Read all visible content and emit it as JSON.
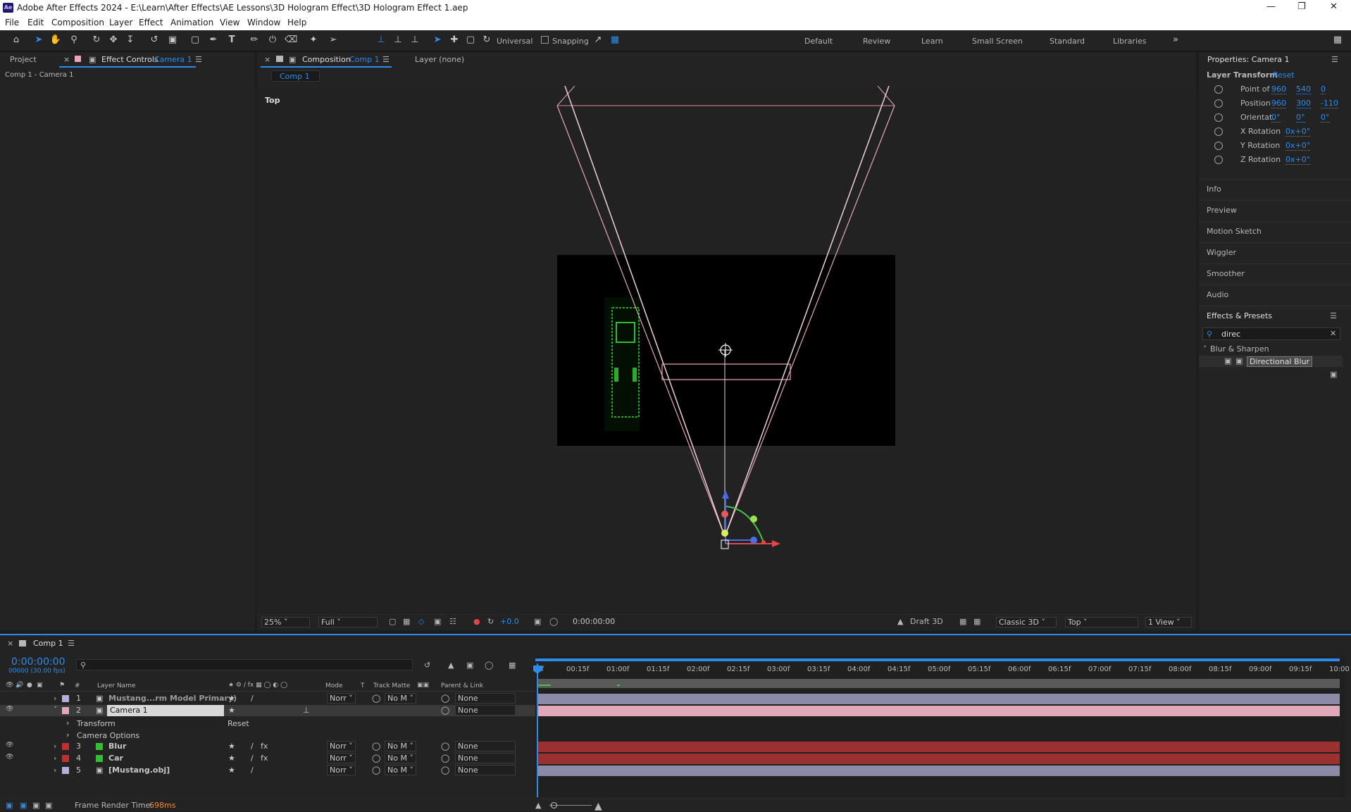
{
  "window": {
    "title": "Adobe After Effects 2024 - E:\\Learn\\After Effects\\AE Lessons\\3D Hologram Effect\\3D Hologram Effect 1.aep",
    "logo": "Ae"
  },
  "menu": [
    "File",
    "Edit",
    "Composition",
    "Layer",
    "Effect",
    "Animation",
    "View",
    "Window",
    "Help"
  ],
  "toolbar": {
    "universal_label": "Universal",
    "snapping_label": "Snapping"
  },
  "workspaces": [
    "Default",
    "Review",
    "Learn",
    "Small Screen",
    "Standard",
    "Libraries"
  ],
  "left_panel": {
    "tab_project": "Project",
    "tab_effect_controls": "Effect Controls",
    "effect_controls_target": "Camera 1",
    "breadcrumb": "Comp 1 - Camera 1"
  },
  "comp_panel": {
    "tab_label": "Composition",
    "tab_comp": "Comp 1",
    "tab_layer": "Layer (none)",
    "subtab": "Comp 1",
    "view_label": "Top",
    "footer": {
      "zoom": "25%",
      "resolution": "Full",
      "exposure": "+0.0",
      "timecode": "0:00:00:00",
      "renderer": "Draft 3D",
      "mode": "Classic 3D",
      "view": "Top",
      "views": "1 View"
    }
  },
  "properties": {
    "title": "Properties: Camera 1",
    "section": "Layer Transform",
    "reset": "Reset",
    "rows": [
      {
        "name": "Point of",
        "values": [
          "960",
          "540",
          "0"
        ]
      },
      {
        "name": "Position",
        "values": [
          "960",
          "300",
          "-110"
        ]
      },
      {
        "name": "Orientat.",
        "values": [
          "0°",
          "0°",
          "0°"
        ]
      },
      {
        "name": "X Rotation",
        "values": [
          "0x+0°"
        ]
      },
      {
        "name": "Y Rotation",
        "values": [
          "0x+0°"
        ]
      },
      {
        "name": "Z Rotation",
        "values": [
          "0x+0°"
        ]
      }
    ],
    "panels": [
      "Info",
      "Preview",
      "Motion Sketch",
      "Wiggler",
      "Smoother",
      "Audio"
    ]
  },
  "effects": {
    "title": "Effects & Presets",
    "search": "direc",
    "category": "Blur & Sharpen",
    "item": "Directional Blur"
  },
  "timeline": {
    "tab": "Comp 1",
    "timecode": "0:00:00:00",
    "frames": "00000 (30.00 fps)",
    "headers": {
      "layer_name": "Layer Name",
      "mode": "Mode",
      "t": "T",
      "track_matte": "Track Matte",
      "parent": "Parent & Link"
    },
    "ruler": [
      "0f",
      "00:15f",
      "01:00f",
      "01:15f",
      "02:00f",
      "02:15f",
      "03:00f",
      "03:15f",
      "04:00f",
      "04:15f",
      "05:00f",
      "05:15f",
      "06:00f",
      "06:15f",
      "07:00f",
      "07:15f",
      "08:00f",
      "08:15f",
      "09:00f",
      "09:15f",
      "10:00"
    ],
    "layers": [
      {
        "num": "1",
        "name": "Mustang...rm Model Primary)",
        "mode": "Norr",
        "matte": "No M",
        "parent": "None",
        "color": "#b0b0d8"
      },
      {
        "num": "2",
        "name": "Camera 1",
        "mode": "",
        "matte": "",
        "parent": "None",
        "color": "#e0a8b8"
      },
      {
        "num": "3",
        "name": "Blur",
        "mode": "Norr",
        "matte": "No M",
        "parent": "None",
        "color": "#c03030"
      },
      {
        "num": "4",
        "name": "Car",
        "mode": "Norr",
        "matte": "No M",
        "parent": "None",
        "color": "#c03030"
      },
      {
        "num": "5",
        "name": "[Mustang.obj]",
        "mode": "Norr",
        "matte": "No M",
        "parent": "None",
        "color": "#b0b0d8"
      }
    ],
    "sub_transform": "Transform",
    "sub_reset": "Reset",
    "sub_camera_options": "Camera Options",
    "render_label": "Frame Render Time:",
    "render_time": "698ms"
  }
}
